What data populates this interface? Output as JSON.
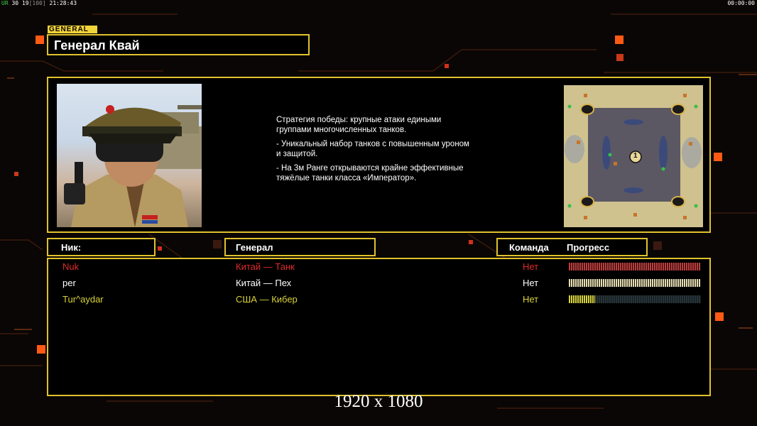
{
  "hud": {
    "left_a": "UR",
    "left_b": "30",
    "left_c": "19",
    "left_d": "[100]",
    "left_time": "21:28:43",
    "right_time": "00:00:00"
  },
  "general": {
    "tag": "GENERAL",
    "name": "Генерал Квай"
  },
  "strategy": {
    "line1": "Стратегия победы: крупные атаки едиными\n группами многочисленных танков.",
    "line2": "- Уникальный набор танков с повышенным уроном\n и защитой.",
    "line3": "- На 3м Ранге открываются крайне эффективные\n тяжёлые танки класса «Император»."
  },
  "minimap": {
    "center_label": "1"
  },
  "columns": {
    "nick": "Ник:",
    "general": "Генерал",
    "team": "Команда",
    "progress": "Прогресс"
  },
  "players": [
    {
      "nick": "Nuk",
      "general": "Китай — Танк",
      "team": "Нет",
      "color": "#e02a2a",
      "progress": 1.0
    },
    {
      "nick": "per",
      "general": "Китай — Пех",
      "team": "Нет",
      "color": "#ffffff",
      "progress": 1.0
    },
    {
      "nick": "Tur^aydar",
      "general": "США — Кибер",
      "team": "Нет",
      "color": "#d8d23a",
      "progress": 0.2
    }
  ],
  "resolution": "1920 x 1080",
  "colors": {
    "accent": "#e0c22c",
    "bar_red": "#c23a3a",
    "bar_light": "#e7dcb0",
    "bar_yellow": "#d8d23a"
  }
}
